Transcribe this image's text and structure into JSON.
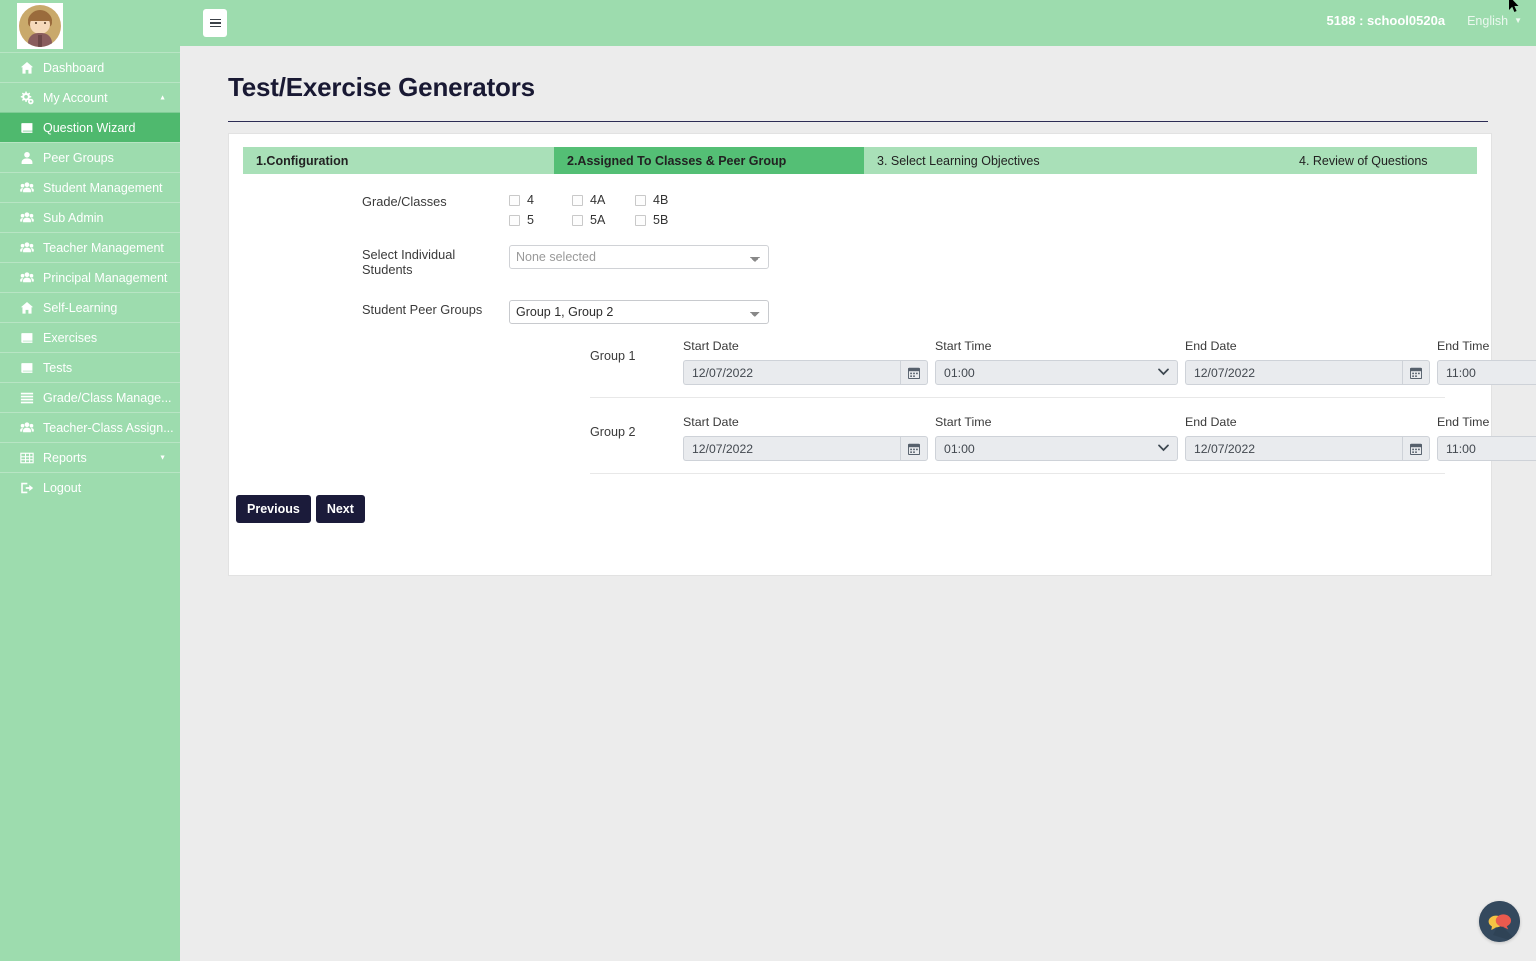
{
  "app": {
    "brand_green": "#9ddcae",
    "active_green": "#4fb96e",
    "tab_active": "#54bf75",
    "tab_inactive": "#a9e0b8",
    "button_navy": "#1b1b3a"
  },
  "sidebar": {
    "avatar_name": "user-avatar",
    "items": [
      {
        "label": "Dashboard",
        "icon": "home-icon",
        "active": false,
        "caret": ""
      },
      {
        "label": "My Account",
        "icon": "gears-icon",
        "active": false,
        "caret": "▲"
      },
      {
        "label": "Question Wizard",
        "icon": "book-icon",
        "active": true,
        "caret": ""
      },
      {
        "label": "Peer Groups",
        "icon": "user-icon",
        "active": false,
        "caret": ""
      },
      {
        "label": "Student Management",
        "icon": "users-icon",
        "active": false,
        "caret": ""
      },
      {
        "label": "Sub Admin",
        "icon": "users-icon",
        "active": false,
        "caret": ""
      },
      {
        "label": "Teacher Management",
        "icon": "users-icon",
        "active": false,
        "caret": ""
      },
      {
        "label": "Principal Management",
        "icon": "users-icon",
        "active": false,
        "caret": ""
      },
      {
        "label": "Self-Learning",
        "icon": "home-icon",
        "active": false,
        "caret": ""
      },
      {
        "label": "Exercises",
        "icon": "book-icon",
        "active": false,
        "caret": ""
      },
      {
        "label": "Tests",
        "icon": "book-icon",
        "active": false,
        "caret": ""
      },
      {
        "label": "Grade/Class Manage...",
        "icon": "list-icon",
        "active": false,
        "caret": ""
      },
      {
        "label": "Teacher-Class Assign...",
        "icon": "users-icon",
        "active": false,
        "caret": ""
      },
      {
        "label": "Reports",
        "icon": "table-icon",
        "active": false,
        "caret": "▼"
      },
      {
        "label": "Logout",
        "icon": "signout-icon",
        "active": false,
        "caret": ""
      }
    ]
  },
  "topbar": {
    "menu_toggle": "hamburger-icon",
    "user": "5188 : school0520a",
    "language": "English",
    "language_caret": "▼"
  },
  "page": {
    "title": "Test/Exercise Generators"
  },
  "tabs": [
    {
      "label": "1.Configuration",
      "active": false
    },
    {
      "label": "2.Assigned To Classes & Peer Group",
      "active": true
    },
    {
      "label": "3. Select Learning Objectives",
      "active": false
    },
    {
      "label": "4. Review of Questions",
      "active": false
    }
  ],
  "form": {
    "grade_classes_label": "Grade/Classes",
    "grade_classes": [
      [
        {
          "label": "4",
          "checked": false
        },
        {
          "label": "4A",
          "checked": false
        },
        {
          "label": "4B",
          "checked": false
        }
      ],
      [
        {
          "label": "5",
          "checked": false
        },
        {
          "label": "5A",
          "checked": false
        },
        {
          "label": "5B",
          "checked": false
        }
      ]
    ],
    "individual_students_label": "Select Individual Students",
    "individual_students_value": "None selected",
    "peer_groups_label": "Student Peer Groups",
    "peer_groups_value": "Group 1, Group 2",
    "col_start_date": "Start Date",
    "col_start_time": "Start Time",
    "col_end_date": "End Date",
    "col_end_time": "End Time",
    "groups": [
      {
        "name": "Group 1",
        "start_date": "12/07/2022",
        "start_time": "01:00",
        "end_date": "12/07/2022",
        "end_time": "11:00"
      },
      {
        "name": "Group 2",
        "start_date": "12/07/2022",
        "start_time": "01:00",
        "end_date": "12/07/2022",
        "end_time": "11:00"
      }
    ]
  },
  "actions": {
    "previous": "Previous",
    "next": "Next"
  },
  "chat": {
    "name": "chat-bubbles-icon",
    "bubble_yellow": "#f5c344",
    "bubble_red": "#ea5a4e",
    "circle": "#34495e"
  }
}
